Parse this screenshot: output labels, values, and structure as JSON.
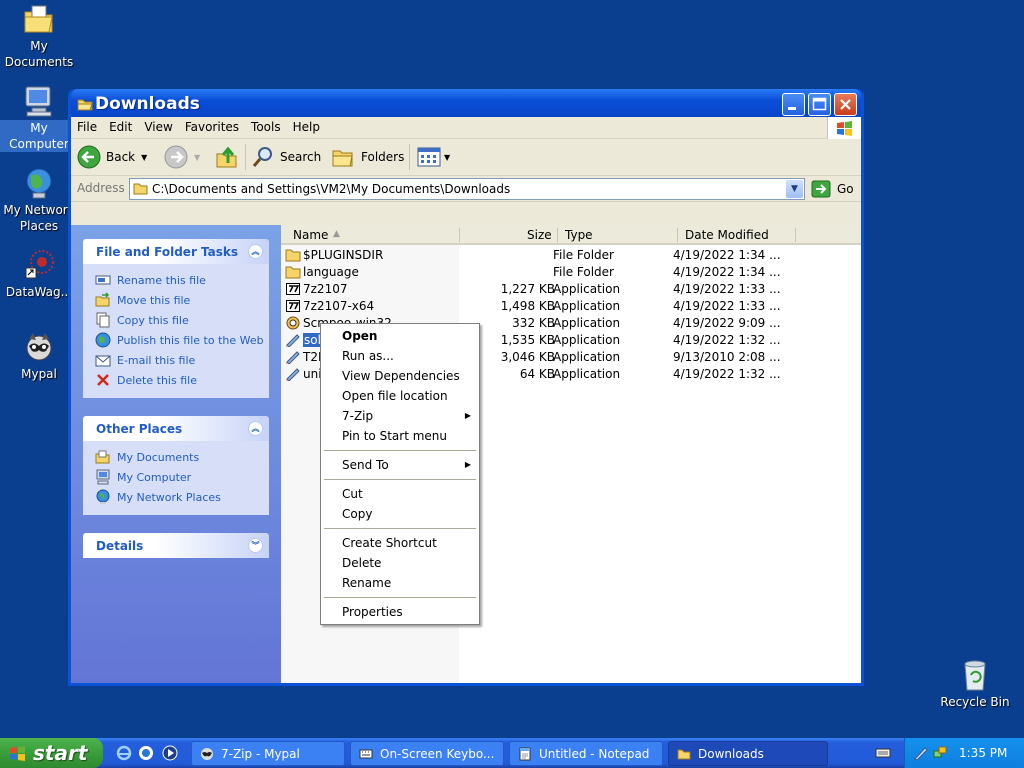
{
  "desktop": {
    "icons": [
      {
        "label": "My Documents"
      },
      {
        "label": "My Computer"
      },
      {
        "label": "My Network Places"
      },
      {
        "label": "DataWag..."
      },
      {
        "label": "Mypal"
      },
      {
        "label": "Recycle Bin"
      }
    ]
  },
  "window": {
    "title": "Downloads",
    "menu": [
      "File",
      "Edit",
      "View",
      "Favorites",
      "Tools",
      "Help"
    ],
    "toolbar": {
      "back": "Back",
      "search": "Search",
      "folders": "Folders"
    },
    "address": {
      "label": "Address",
      "value": "C:\\Documents and Settings\\VM2\\My Documents\\Downloads",
      "go": "Go"
    }
  },
  "taskpane": {
    "file_tasks": {
      "title": "File and Folder Tasks",
      "items": [
        "Rename this file",
        "Move this file",
        "Copy this file",
        "Publish this file to the Web",
        "E-mail this file",
        "Delete this file"
      ]
    },
    "other_places": {
      "title": "Other Places",
      "items": [
        "My Documents",
        "My Computer",
        "My Network Places"
      ]
    },
    "details": {
      "title": "Details"
    }
  },
  "filelist": {
    "columns": {
      "name": "Name",
      "size": "Size",
      "type": "Type",
      "date": "Date Modified"
    },
    "rows": [
      {
        "name": "$PLUGINSDIR",
        "size": "",
        "type": "File Folder",
        "date": "4/19/2022 1:34 ...",
        "icon": "folder-icon"
      },
      {
        "name": "language",
        "size": "",
        "type": "File Folder",
        "date": "4/19/2022 1:34 ...",
        "icon": "folder-icon"
      },
      {
        "name": "7z2107",
        "size": "1,227 KB",
        "type": "Application",
        "date": "4/19/2022 1:33 ...",
        "icon": "7zip-icon"
      },
      {
        "name": "7z2107-x64",
        "size": "1,498 KB",
        "type": "Application",
        "date": "4/19/2022 1:33 ...",
        "icon": "7zip-icon"
      },
      {
        "name": "Scmpoo-win32",
        "size": "332 KB",
        "type": "Application",
        "date": "4/19/2022 9:09 ...",
        "icon": "sheep-icon"
      },
      {
        "name": "solaris-7z",
        "size": "1,535 KB",
        "type": "Application",
        "date": "4/19/2022 1:32 ...",
        "icon": "rocket-icon"
      },
      {
        "name": "T2E",
        "size": "3,046 KB",
        "type": "Application",
        "date": "9/13/2010 2:08 ...",
        "icon": "rocket-icon"
      },
      {
        "name": "uni",
        "size": "64 KB",
        "type": "Application",
        "date": "4/19/2022 1:32 ...",
        "icon": "rocket-icon"
      }
    ],
    "selected_display": "solaris-7z"
  },
  "context_menu": {
    "items": [
      "Open",
      "Run as...",
      "View Dependencies",
      "Open file location",
      "7-Zip",
      "Pin to Start menu",
      "Send To",
      "Cut",
      "Copy",
      "Create Shortcut",
      "Delete",
      "Rename",
      "Properties"
    ]
  },
  "taskbar": {
    "start": "start",
    "tasks": [
      "7-Zip - Mypal",
      "On-Screen Keybo...",
      "Untitled - Notepad",
      "Downloads"
    ],
    "clock": "1:35 PM"
  }
}
